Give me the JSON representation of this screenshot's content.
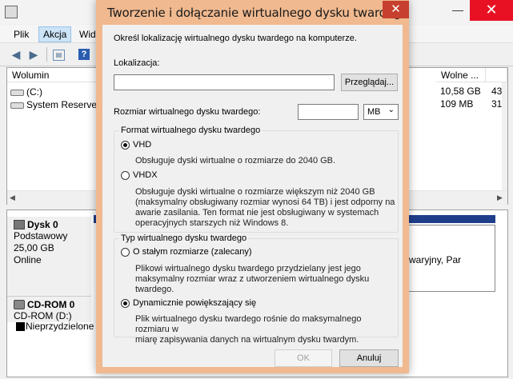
{
  "background_app": {
    "menu": [
      "Plik",
      "Akcja",
      "Wido"
    ],
    "columns": {
      "volume": "Wolumin",
      "free": "Wolne ..."
    },
    "volumes": [
      {
        "name": "(C:)",
        "free": "10,58 GB",
        "pct": "43"
      },
      {
        "name": "System Reserved",
        "free": "109 MB",
        "pct": "31"
      }
    ],
    "disks": [
      {
        "title": "Dysk 0",
        "type": "Podstawowy",
        "size": "25,00 GB",
        "status": "Online"
      },
      {
        "title": "CD-ROM 0",
        "drive": "CD-ROM (D:)"
      }
    ],
    "partition_fragment": "cut awaryjny, Par",
    "legend": "Nieprzydzielone"
  },
  "dialog": {
    "title": "Tworzenie i dołączanie wirtualnego dysku twardego",
    "intro": "Określ lokalizację wirtualnego dysku twardego na komputerze.",
    "location_label": "Lokalizacja:",
    "location_value": "",
    "browse_button": "Przeglądaj...",
    "size_label": "Rozmiar wirtualnego dysku twardego:",
    "size_value": "",
    "size_unit": "MB",
    "format_group": {
      "title": "Format wirtualnego dysku twardego",
      "options": [
        {
          "label": "VHD",
          "selected": true,
          "desc": "Obsługuje dyski wirtualne o rozmiarze do 2040 GB."
        },
        {
          "label": "VHDX",
          "selected": false,
          "desc": [
            "Obsługuje dyski wirtualne o rozmiarze większym niż 2040 GB",
            "(maksymalny obsługiwany rozmiar wynosi 64 TB) i jest odporny na",
            "awarie zasilania. Ten format nie jest obsługiwany w systemach",
            "operacyjnych starszych niż Windows 8."
          ]
        }
      ]
    },
    "type_group": {
      "title": "Typ wirtualnego dysku twardego",
      "options": [
        {
          "label": "O stałym rozmiarze (zalecany)",
          "selected": false,
          "desc": [
            "Plikowi wirtualnego dysku twardego przydzielany jest jego",
            "maksymalny rozmiar wraz z utworzeniem wirtualnego dysku twardego."
          ]
        },
        {
          "label": "Dynamicznie powiększający się",
          "selected": true,
          "desc": [
            "Plik wirtualnego dysku twardego rośnie do maksymalnego rozmiaru w",
            "miarę zapisywania danych na wirtualnym dysku twardym."
          ]
        }
      ]
    },
    "ok_button": "OK",
    "cancel_button": "Anuluj"
  }
}
